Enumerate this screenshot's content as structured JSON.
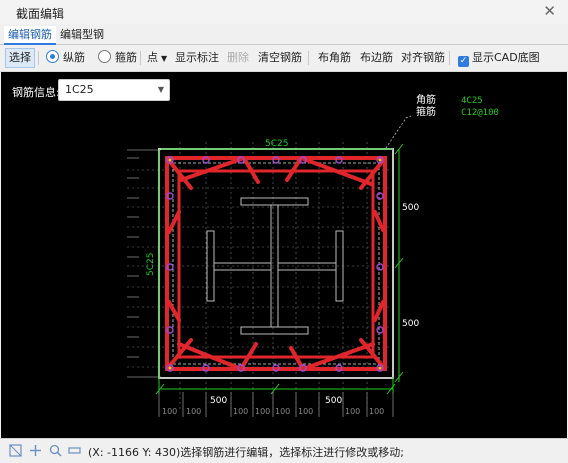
{
  "window": {
    "title": "截面编辑",
    "close_glyph": "✕"
  },
  "tabs": [
    {
      "label": "编辑钢筋",
      "active": true
    },
    {
      "label": "编辑型钢",
      "active": false
    }
  ],
  "toolbar": {
    "select": "选择",
    "longitudinal": "纵筋",
    "stirrup": "箍筋",
    "point": "点",
    "show_annotation": "显示标注",
    "delete": "删除",
    "clear": "清空钢筋",
    "corner": "布角筋",
    "edge": "布边筋",
    "align": "对齐钢筋",
    "show_cad": "显示CAD底图"
  },
  "rebar_info": {
    "label": "钢筋信息:",
    "value": "1C25"
  },
  "legend": {
    "corner_label": "角筋",
    "corner_value": "4C25",
    "stirrup_label": "箍筋",
    "stirrup_value": "C12@100"
  },
  "dimensions": {
    "top": "5C25",
    "left": "5C25",
    "right_upper": "500",
    "right_lower": "500",
    "bottom_left": "500",
    "bottom_right": "500",
    "small": "100"
  },
  "status": {
    "text": "(X: -1166 Y: 430)选择钢筋进行编辑，选择标注进行修改或移动;"
  },
  "colors": {
    "stirrup": "#e0262b",
    "dim": "#22cc22",
    "bar": "#9a4bd6",
    "frame": "#bfbfbf",
    "accent": "#2f7be0"
  }
}
